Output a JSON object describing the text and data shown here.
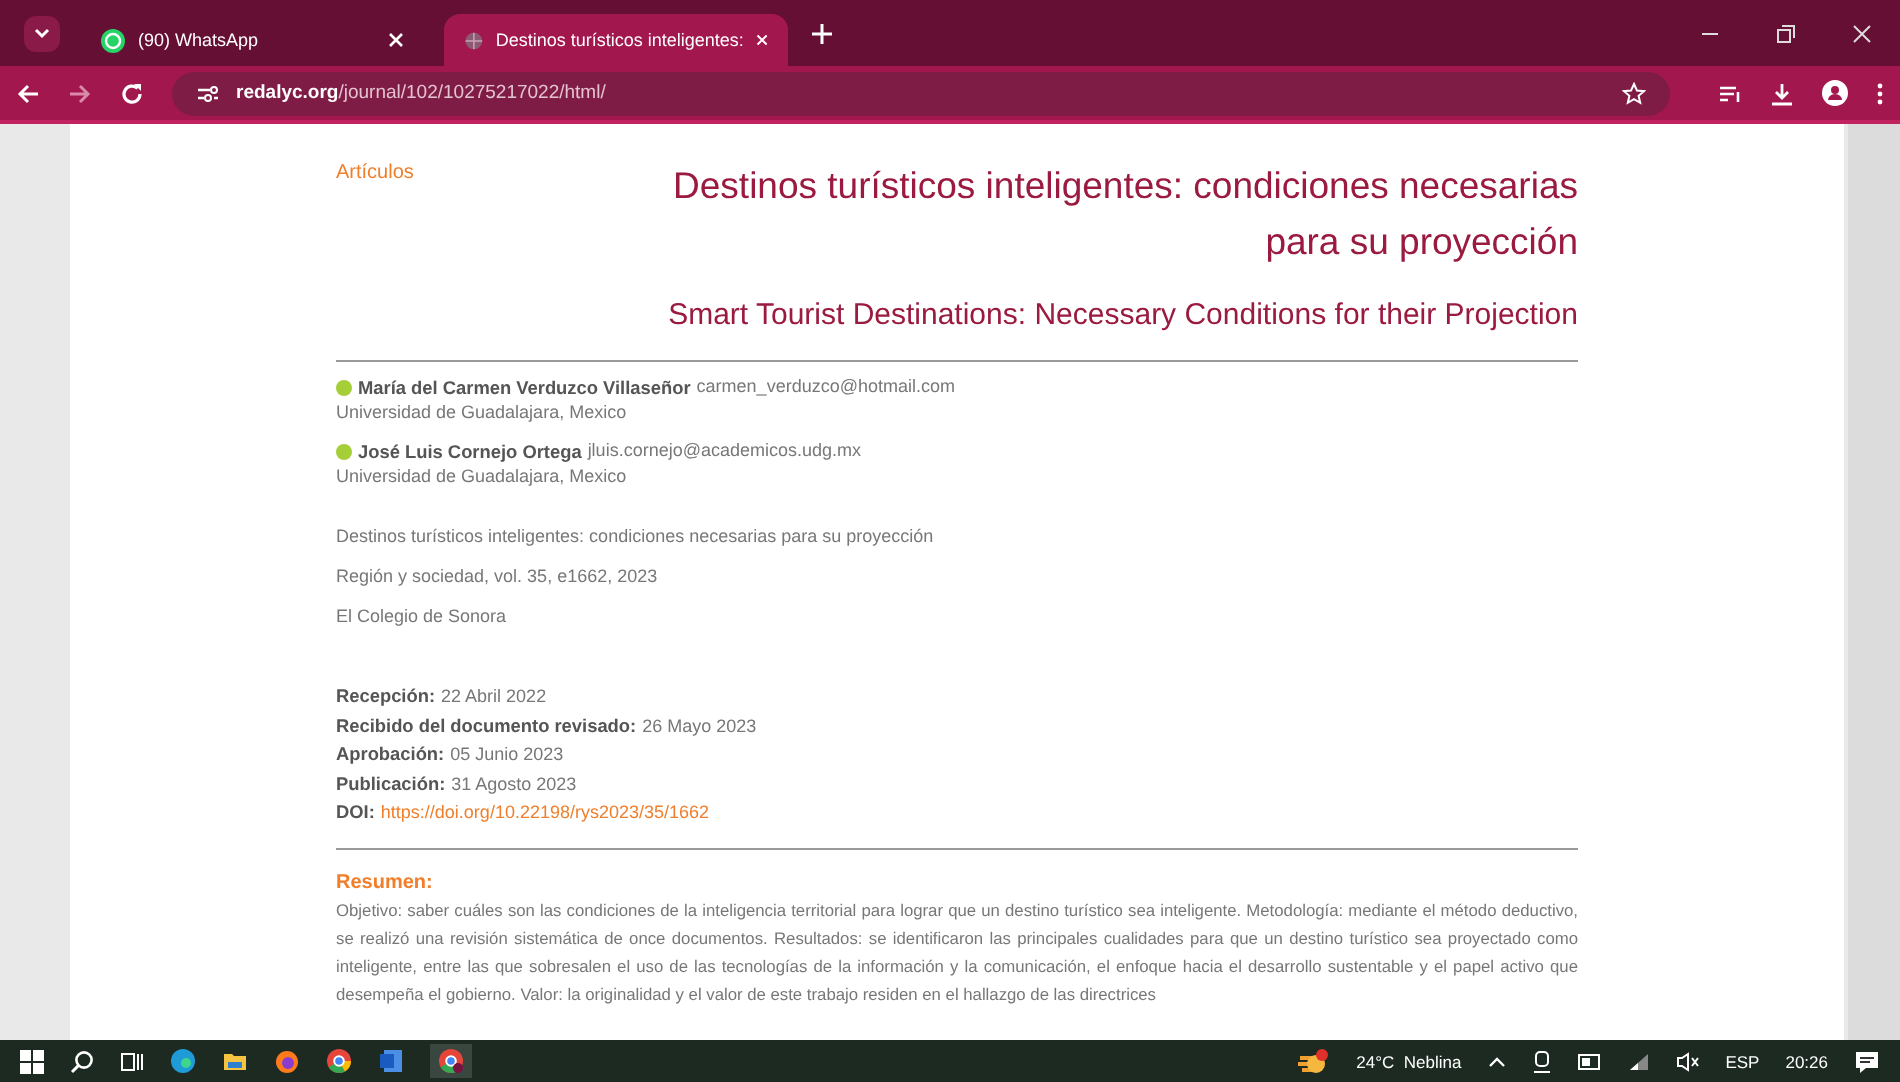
{
  "browser": {
    "tabs": [
      {
        "title": "(90) WhatsApp",
        "selected": false
      },
      {
        "title": "Destinos turísticos inteligentes:",
        "selected": true
      }
    ],
    "address": {
      "host": "redalyc.org",
      "path": "/journal/102/10275217022/html/"
    }
  },
  "article": {
    "section": "Artículos",
    "title": "Destinos turísticos inteligentes: condiciones necesarias para su proyección",
    "title_en": "Smart Tourist Destinations: Necessary Conditions for their Projection",
    "authors": [
      {
        "name": "María del Carmen Verduzco Villaseñor",
        "email": "carmen_verduzco@hotmail.com",
        "affiliation": "Universidad de Guadalajara, Mexico"
      },
      {
        "name": "José Luis Cornejo Ortega",
        "email": "jluis.cornejo@academicos.udg.mx",
        "affiliation": "Universidad de Guadalajara, Mexico"
      }
    ],
    "citation": [
      "Destinos turísticos inteligentes: condiciones necesarias para su proyección",
      "Región y sociedad, vol. 35, e1662, 2023",
      "El Colegio de Sonora"
    ],
    "dates": [
      {
        "label": "Recepción:",
        "value": "22 Abril 2022",
        "kind": "text"
      },
      {
        "label": "Recibido del documento revisado:",
        "value": "26 Mayo 2023",
        "kind": "text"
      },
      {
        "label": "Aprobación:",
        "value": "05 Junio 2023",
        "kind": "text"
      },
      {
        "label": "Publicación:",
        "value": "31 Agosto 2023",
        "kind": "text"
      },
      {
        "label": "DOI:",
        "value": "https://doi.org/10.22198/rys2023/35/1662",
        "kind": "link"
      }
    ],
    "abstract_heading": "Resumen:",
    "abstract": "Objetivo: saber cuáles son las condiciones de la inteligencia territorial para lograr que un destino turístico sea inteligente. Metodología: mediante el método deductivo, se realizó una revisión sistemática de once documentos. Resultados: se identificaron las principales cualidades para que un destino turístico sea proyectado como inteligente, entre las que sobresalen el uso de las tecnologías de la información y la comunicación, el enfoque hacia el desarrollo sustentable y el papel activo que desempeña el gobierno. Valor: la originalidad y el valor de este trabajo residen en el hallazgo de las directrices"
  },
  "taskbar": {
    "weather": "24°C  Neblina",
    "language": "ESP",
    "time": "20:26"
  }
}
